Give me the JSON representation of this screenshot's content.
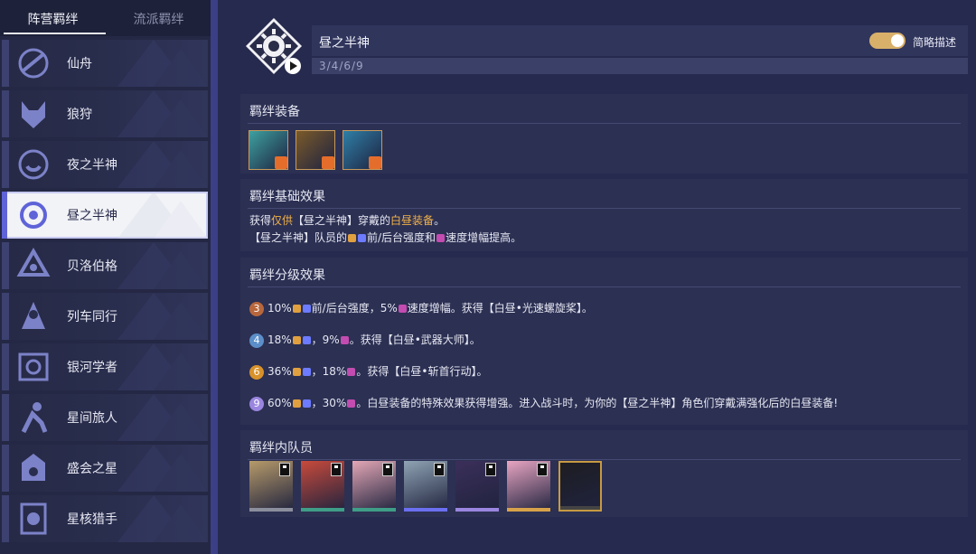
{
  "sidebar": {
    "tabs": [
      "阵营羁绊",
      "流派羁绊"
    ],
    "items": [
      {
        "label": "仙舟",
        "icon": "xianzhou-emblem-icon"
      },
      {
        "label": "狼狩",
        "icon": "wolf-emblem-icon"
      },
      {
        "label": "夜之半神",
        "icon": "night-demigod-emblem-icon"
      },
      {
        "label": "昼之半神",
        "icon": "day-demigod-emblem-icon",
        "selected": true
      },
      {
        "label": "贝洛伯格",
        "icon": "belobog-emblem-icon"
      },
      {
        "label": "列车同行",
        "icon": "express-emblem-icon"
      },
      {
        "label": "银河学者",
        "icon": "galaxy-scholar-emblem-icon"
      },
      {
        "label": "星间旅人",
        "icon": "traveler-emblem-icon"
      },
      {
        "label": "盛会之星",
        "icon": "festival-star-emblem-icon"
      },
      {
        "label": "星核猎手",
        "icon": "stellaron-hunter-emblem-icon"
      }
    ]
  },
  "header": {
    "title": "昼之半神",
    "tiers": "3/4/6/9",
    "toggle_label": "简略描述",
    "toggle_on": true
  },
  "equipment": {
    "title": "羁绊装备",
    "items": [
      {
        "icon": "propeller-equipment-icon",
        "color": "#3ea1a0"
      },
      {
        "icon": "weapon-master-equipment-icon",
        "color": "#7a5a2a"
      },
      {
        "icon": "blade-equipment-icon",
        "color": "#2f7fa6"
      }
    ]
  },
  "base_effect": {
    "title": "羁绊基础效果",
    "line1_a": "获得",
    "line1_hl1": "仅供",
    "line1_b": "【昼之半神】穿戴的",
    "line1_hl2": "白昼装备",
    "line1_c": "。",
    "line2_a": "【昼之半神】队员的",
    "line2_b": "前/后台强度和",
    "line2_c": "速度增幅提高。"
  },
  "tier_effect": {
    "title": "羁绊分级效果",
    "rows": [
      {
        "tier": "3",
        "color": "#b8673c",
        "a": "10%",
        "b": "前/后台强度，5%",
        "c": "速度增幅。获得【白昼•光速螺旋桨】。"
      },
      {
        "tier": "4",
        "color": "#5c8fc9",
        "a": "18%",
        "b": "，9%",
        "c": "。获得【白昼•武器大师】。"
      },
      {
        "tier": "6",
        "color": "#d8922a",
        "a": "36%",
        "b": "，18%",
        "c": "。获得【白昼•斩首行动】。"
      },
      {
        "tier": "9",
        "color": "#9a86e0",
        "a": "60%",
        "b": "，30%",
        "c": "。白昼装备的特殊效果获得增强。进入战斗时，为你的【昼之半神】角色们穿戴满强化后的白昼装备!"
      }
    ]
  },
  "members": {
    "title": "羁绊内队员",
    "list": [
      {
        "icon": "member-portrait-1",
        "bg": "#b69a6a",
        "strip": "#8b8e9c"
      },
      {
        "icon": "member-portrait-2",
        "bg": "#c84a3c",
        "strip": "#3f9e88"
      },
      {
        "icon": "member-portrait-3",
        "bg": "#e3a7b5",
        "strip": "#3f9e88"
      },
      {
        "icon": "member-portrait-4",
        "bg": "#8fa3b4",
        "strip": "#6b6ff0"
      },
      {
        "icon": "member-portrait-5",
        "bg": "#3b2f5a",
        "strip": "#9a86e0"
      },
      {
        "icon": "member-portrait-6",
        "bg": "#e8a5c2",
        "strip": "#d8a24a"
      },
      {
        "icon": "member-portrait-7",
        "bg": "#1d1d22",
        "strip": "#444"
      }
    ]
  }
}
